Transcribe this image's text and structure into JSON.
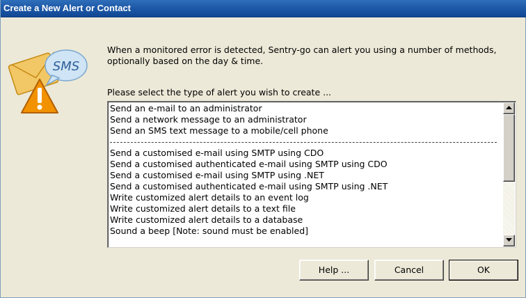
{
  "window": {
    "title": "Create a New Alert or Contact"
  },
  "icon": {
    "name": "sms-alert-icon",
    "badge_text": "SMS"
  },
  "intro": {
    "line1": "When a monitored error is detected, Sentry-go can alert you using a number of methods,",
    "line2": "optionally based on the day & time."
  },
  "prompt": "Please select the type of alert you wish to create ...",
  "alert_types": {
    "items": [
      "Send an e-mail to an administrator",
      "Send a network message to an administrator",
      "Send an SMS text message to a mobile/cell phone",
      "",
      "Send a customised e-mail using SMTP using CDO",
      "Send a customised authenticated e-mail using SMTP using CDO",
      "Send a customised e-mail using SMTP using .NET",
      "Send a customised authenticated e-mail using SMTP using .NET",
      "Write customized alert details to an event log",
      "Write customized alert details to a text file",
      "Write customized alert details to a database",
      "Sound a beep [Note: sound must be enabled]"
    ]
  },
  "buttons": {
    "help": "Help ...",
    "cancel": "Cancel",
    "ok": "OK"
  },
  "colors": {
    "title_bar": "#1e5aa8",
    "dialog_bg": "#ece9d8",
    "envelope": "#f2c766",
    "bubble": "#cfe4f5",
    "warning": "#f29200"
  }
}
